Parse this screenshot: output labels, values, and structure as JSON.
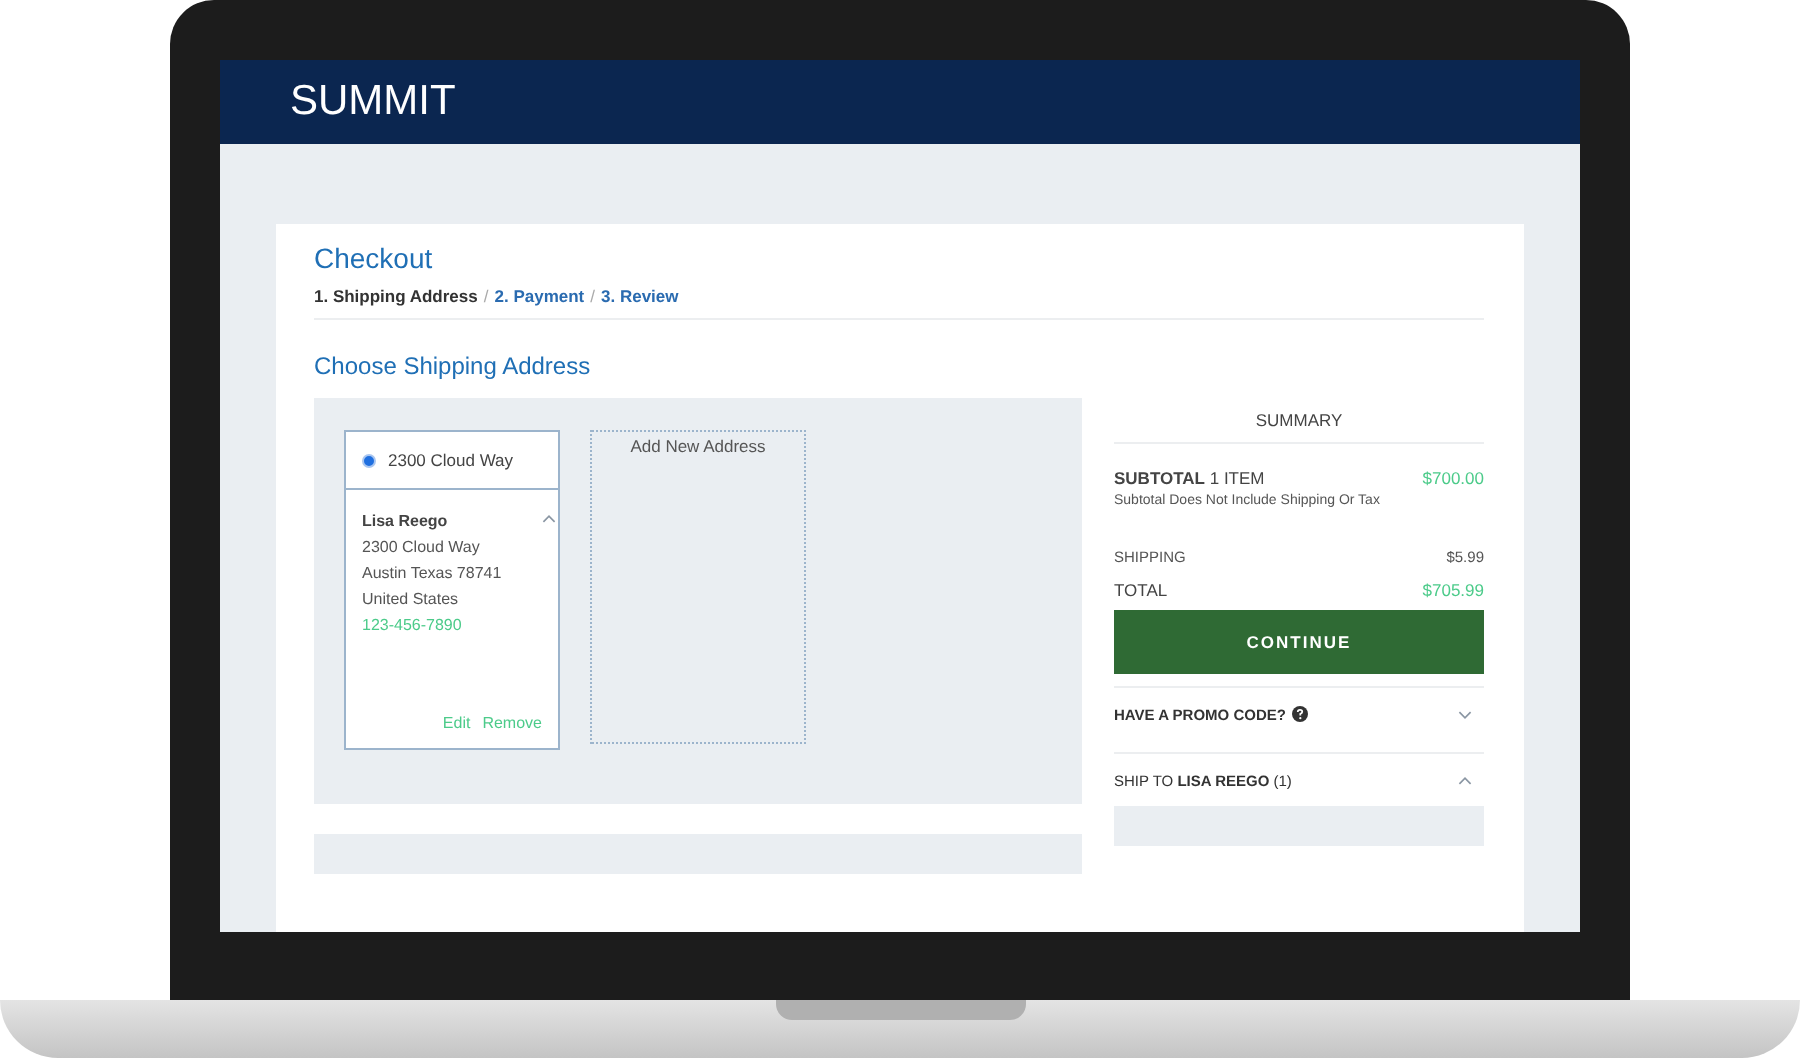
{
  "header": {
    "brand": "SUMMIT"
  },
  "checkout": {
    "title": "Checkout",
    "step_separator": "/",
    "steps": [
      {
        "label": "1. Shipping Address",
        "selected": true
      },
      {
        "label": "2. Payment",
        "selected": false
      },
      {
        "label": "3. Review",
        "selected": false
      }
    ],
    "section_title": "Choose Shipping Address",
    "addresses": [
      {
        "label": "2300 Cloud Way",
        "selected": true,
        "expanded": true,
        "name": "Lisa Reego",
        "lines": [
          "2300 Cloud Way",
          "Austin Texas 78741",
          "United States"
        ],
        "phone": "123-456-7890",
        "actions": [
          "Edit",
          "Remove"
        ]
      }
    ],
    "add_new": "Add New Address"
  },
  "summary": {
    "title": "SUMMARY",
    "subtotal_label": "**SUBTOTAL** 1 ITEM",
    "subtotal": "$700.00",
    "note": "Subtotal Does Not Include Shipping Or Tax",
    "shipping_label": "SHIPPING",
    "shipping": "$5.99",
    "total_label": "TOTAL",
    "total": "$705.99",
    "button": "CONTINUE",
    "sections": [
      {
        "label": "**HAVE A PROMO CODE?**",
        "help": true,
        "expanded": false
      },
      {
        "label": "SHIP TO **LISA REEGO** (1)",
        "help": false,
        "expanded": true
      }
    ]
  }
}
